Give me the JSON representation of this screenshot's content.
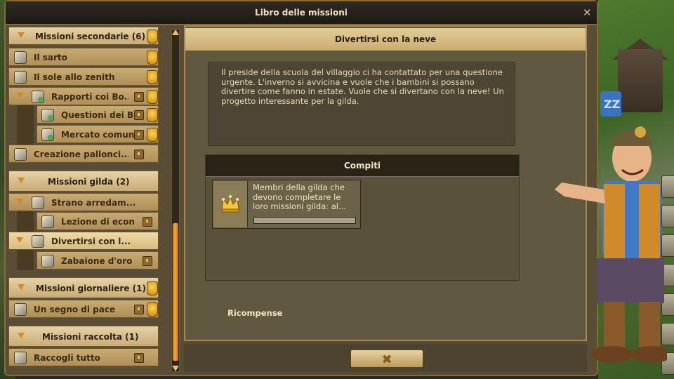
{
  "window": {
    "title": "Libro delle missioni",
    "close_icon": "close-icon"
  },
  "list": {
    "groups": [
      {
        "label": "Missioni secondarie (6)"
      },
      {
        "label": "Missioni gilda (2)"
      },
      {
        "label": "Missioni giornaliere (1)"
      },
      {
        "label": "Missioni raccolta (1)"
      }
    ],
    "items": [
      {
        "label": "Il sarto"
      },
      {
        "label": "Il sole allo zenith"
      },
      {
        "label": "Rapporti coi Bo..."
      },
      {
        "label": "Questioni dei B..."
      },
      {
        "label": "Mercato comune I"
      },
      {
        "label": "Creazione pallonci..."
      },
      {
        "label": "Strano arredam..."
      },
      {
        "label": "Lezione di econ..."
      },
      {
        "label": "Divertirsi con l..."
      },
      {
        "label": "Zabaione d'oro"
      },
      {
        "label": "Un segno di pace"
      },
      {
        "label": "Raccogli tutto"
      }
    ]
  },
  "mission": {
    "title": "Divertirsi con la neve",
    "description": "Il preside della scuola del villaggio ci ha contattato per una questione urgente. L'inverno si avvicina e vuole che i bambini si possano divertire come fanno in estate. Vuole che si divertano con la neve! Un progetto interessante per la gilda.",
    "tasks_title": "Compiti",
    "task_text": "Membri della gilda che devono completare le loro missioni gilda: al...",
    "task_progress": 0,
    "rewards_label": "Ricompense"
  },
  "footer": {
    "close_glyph": "✖"
  },
  "colors": {
    "accent": "#d9871d",
    "panel": "#615840",
    "header": "#e2cc97"
  }
}
